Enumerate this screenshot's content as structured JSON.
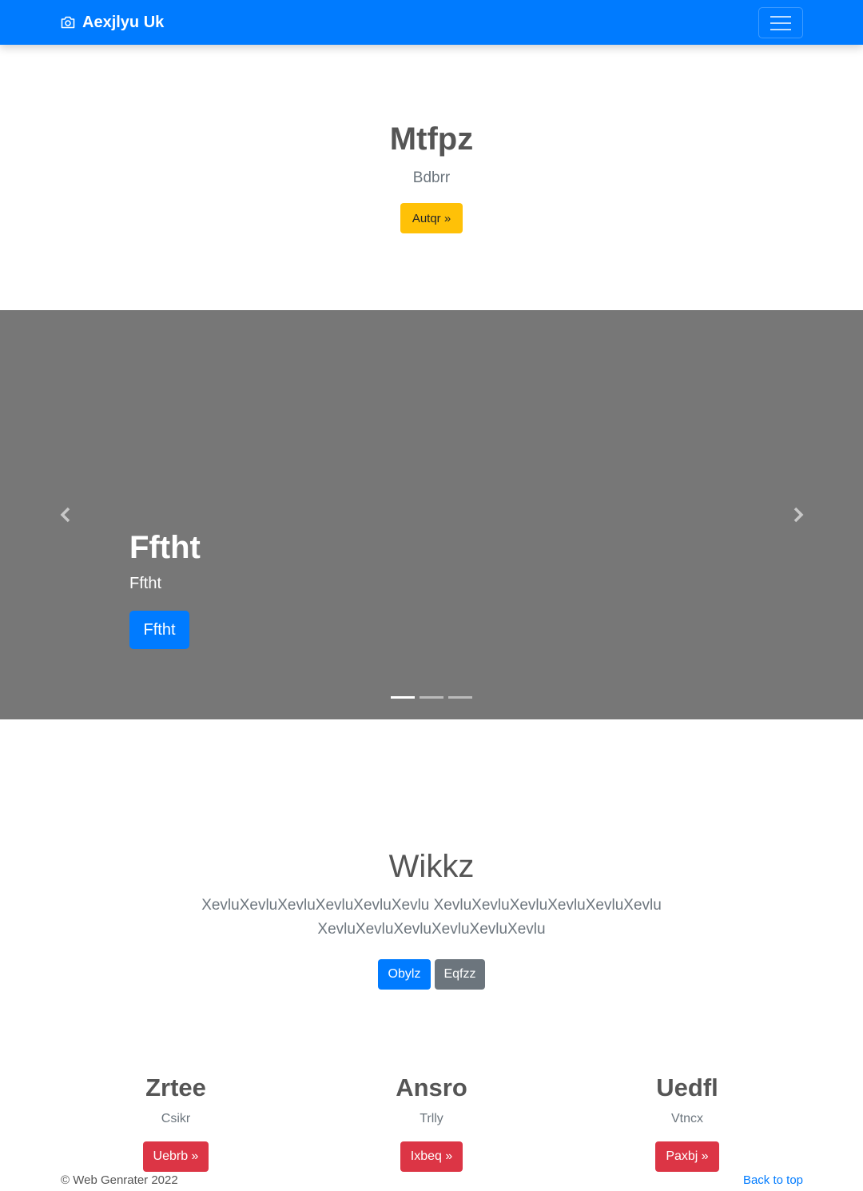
{
  "navbar": {
    "brand": "Aexjlyu Uk",
    "brand_icon": "camera-icon",
    "toggler_icon": "hamburger-menu-icon",
    "color": "#007bff"
  },
  "hero": {
    "title": "Mtfpz",
    "subtitle": "Bdbrr",
    "button": "Autqr »"
  },
  "carousel": {
    "title": "Fftht",
    "text": "Fftht",
    "button": "Fftht",
    "prev_icon": "chevron-left-icon",
    "next_icon": "chevron-right-icon",
    "slide_count": 3,
    "active_slide": 1
  },
  "about": {
    "title": "Wikkz",
    "text": "XevluXevluXevluXevluXevluXevlu XevluXevluXevluXevluXevluXevlu XevluXevluXevluXevluXevluXevlu",
    "primary_button": "Obylz",
    "secondary_button": "Eqfzz"
  },
  "columns": [
    {
      "title": "Zrtee",
      "text": "Csikr",
      "button": "Uebrb »"
    },
    {
      "title": "Ansro",
      "text": "Trlly",
      "button": "Ixbeq »"
    },
    {
      "title": "Uedfl",
      "text": "Vtncx",
      "button": "Paxbj »"
    }
  ],
  "footer": {
    "copyright": "© Web Genrater 2022",
    "back_to_top": "Back to top"
  }
}
